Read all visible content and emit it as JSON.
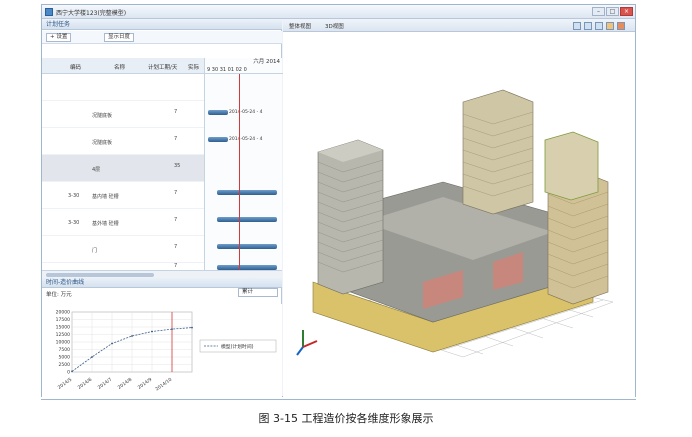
{
  "app": {
    "title": "西宁大学楼123(完整模型)"
  },
  "left_panel": {
    "plan_header": "计划任务",
    "toolbar": {
      "setting": "设置",
      "show_toggle": "显示日度"
    },
    "grid": {
      "headers": [
        "编码",
        "名称",
        "计划工期/天",
        "实际"
      ],
      "rows": [
        {
          "prefix": "",
          "name": "",
          "value": ""
        },
        {
          "prefix": "",
          "name": "况隧底板",
          "value": "7"
        },
        {
          "prefix": "",
          "name": "况隧底板",
          "value": "7"
        },
        {
          "prefix": "",
          "name": "4层",
          "value": "35"
        },
        {
          "prefix": "3-30",
          "name": "基内墙 砼槽",
          "value": "7"
        },
        {
          "prefix": "3-30",
          "name": "基外墙 砼槽",
          "value": "7"
        },
        {
          "prefix": "",
          "name": "门",
          "value": "7"
        },
        {
          "prefix": "",
          "name": "",
          "value": "7"
        }
      ]
    },
    "gantt": {
      "month_label": "六月 2014",
      "days": "9  30  31  01  02  0",
      "bar_texts": [
        "2014-05-24 - 4",
        "2014-05-24 - 4"
      ]
    },
    "chart_header": "时间-造价曲线",
    "unit_label": "单位: 万元",
    "type_select": "累计"
  },
  "right_panel": {
    "viewport_labels": [
      "整体视图",
      "3D视图"
    ]
  },
  "caption": "图 3-15 工程造价按各维度形象展示",
  "chart_data": {
    "type": "line",
    "title": "",
    "xlabel": "",
    "ylabel": "",
    "ylim": [
      0,
      20000
    ],
    "yticks": [
      0,
      2500,
      5000,
      7500,
      10000,
      12500,
      15000,
      17500,
      20000
    ],
    "x": [
      "2014-5",
      "2014-6",
      "2014-7",
      "2014-8",
      "2014-9",
      "2014-10",
      "2014-11"
    ],
    "xtick_labels": [
      "2014/5",
      "2014/6",
      "2014/7",
      "2014/8",
      "2014/9",
      "2014/10"
    ],
    "series": [
      {
        "name": "模型(计划时间)",
        "values": [
          200,
          5000,
          9500,
          12000,
          13500,
          14300,
          14800
        ],
        "color": "#3b5a86"
      }
    ],
    "marker_x": "2014-10",
    "legend": "right",
    "grid": true
  }
}
